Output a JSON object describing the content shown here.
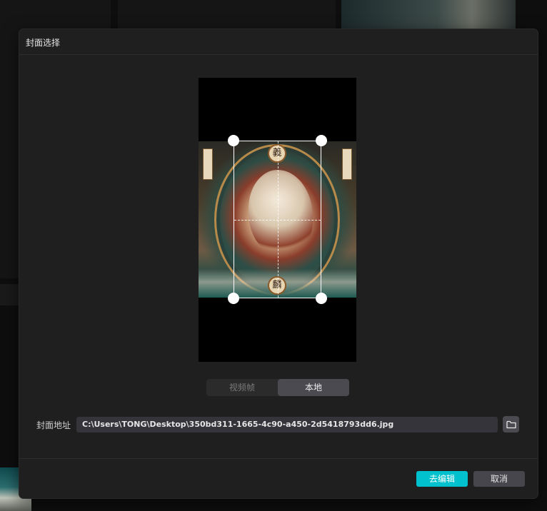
{
  "dialog": {
    "title": "封面选择"
  },
  "preview": {
    "top_glyph": "義",
    "bottom_glyph": "麟"
  },
  "tabs": [
    {
      "label": "视频帧",
      "active": false
    },
    {
      "label": "本地",
      "active": true
    }
  ],
  "cover_path": {
    "label": "封面地址",
    "value": "C:\\Users\\TONG\\Desktop\\350bd311-1665-4c90-a450-2d5418793dd6.jpg"
  },
  "buttons": {
    "edit": "去编辑",
    "cancel": "取消"
  },
  "colors": {
    "accent": "#00c1cd",
    "dialog_bg": "#1f1f1f",
    "input_bg": "#34343a"
  },
  "icons": {
    "folder": "folder-icon"
  }
}
